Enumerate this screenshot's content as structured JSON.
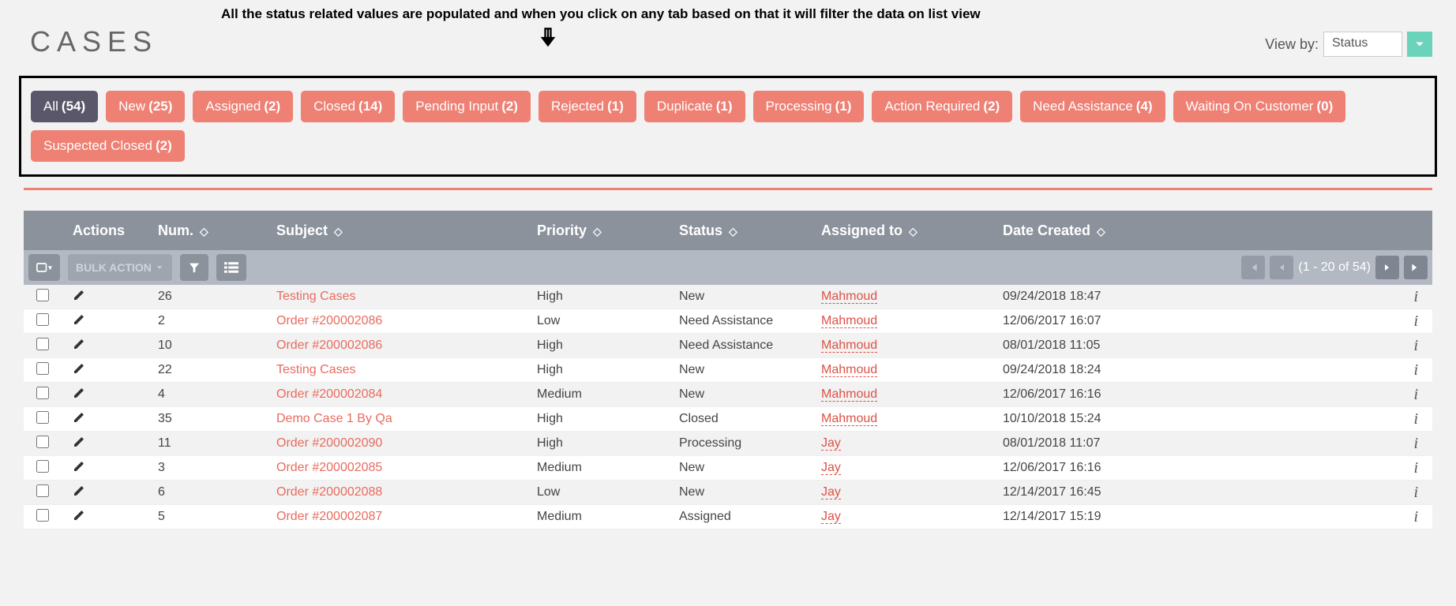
{
  "page": {
    "title": "CASES",
    "annotation": "All the status related values are populated and when you click on any tab based on that it will filter the data on list view",
    "viewby_label": "View by:",
    "viewby_value": "Status"
  },
  "tabs": [
    {
      "label": "All",
      "count": "(54)",
      "active": true
    },
    {
      "label": "New",
      "count": "(25)",
      "active": false
    },
    {
      "label": "Assigned",
      "count": "(2)",
      "active": false
    },
    {
      "label": "Closed",
      "count": "(14)",
      "active": false
    },
    {
      "label": "Pending Input",
      "count": "(2)",
      "active": false
    },
    {
      "label": "Rejected",
      "count": "(1)",
      "active": false
    },
    {
      "label": "Duplicate",
      "count": "(1)",
      "active": false
    },
    {
      "label": "Processing",
      "count": "(1)",
      "active": false
    },
    {
      "label": "Action Required",
      "count": "(2)",
      "active": false
    },
    {
      "label": "Need Assistance",
      "count": "(4)",
      "active": false
    },
    {
      "label": "Waiting On Customer",
      "count": "(0)",
      "active": false
    },
    {
      "label": "Suspected Closed",
      "count": "(2)",
      "active": false
    }
  ],
  "columns": {
    "actions": "Actions",
    "num": "Num.",
    "subject": "Subject",
    "priority": "Priority",
    "status": "Status",
    "assigned": "Assigned to",
    "date": "Date Created"
  },
  "toolbar": {
    "bulk_action": "BULK ACTION",
    "pager_text": "(1 - 20 of 54)"
  },
  "rows": [
    {
      "num": "26",
      "subject": "Testing Cases",
      "priority": "High",
      "status": "New",
      "assigned": "Mahmoud",
      "date": "09/24/2018 18:47"
    },
    {
      "num": "2",
      "subject": "Order #200002086",
      "priority": "Low",
      "status": "Need Assistance",
      "assigned": "Mahmoud",
      "date": "12/06/2017 16:07"
    },
    {
      "num": "10",
      "subject": "Order #200002086",
      "priority": "High",
      "status": "Need Assistance",
      "assigned": "Mahmoud",
      "date": "08/01/2018 11:05"
    },
    {
      "num": "22",
      "subject": "Testing Cases",
      "priority": "High",
      "status": "New",
      "assigned": "Mahmoud",
      "date": "09/24/2018 18:24"
    },
    {
      "num": "4",
      "subject": "Order #200002084",
      "priority": "Medium",
      "status": "New",
      "assigned": "Mahmoud",
      "date": "12/06/2017 16:16"
    },
    {
      "num": "35",
      "subject": "Demo Case 1 By Qa",
      "priority": "High",
      "status": "Closed",
      "assigned": "Mahmoud",
      "date": "10/10/2018 15:24"
    },
    {
      "num": "11",
      "subject": "Order #200002090",
      "priority": "High",
      "status": "Processing",
      "assigned": "Jay",
      "date": "08/01/2018 11:07"
    },
    {
      "num": "3",
      "subject": "Order #200002085",
      "priority": "Medium",
      "status": "New",
      "assigned": "Jay",
      "date": "12/06/2017 16:16"
    },
    {
      "num": "6",
      "subject": "Order #200002088",
      "priority": "Low",
      "status": "New",
      "assigned": "Jay",
      "date": "12/14/2017 16:45"
    },
    {
      "num": "5",
      "subject": "Order #200002087",
      "priority": "Medium",
      "status": "Assigned",
      "assigned": "Jay",
      "date": "12/14/2017 15:19"
    }
  ]
}
